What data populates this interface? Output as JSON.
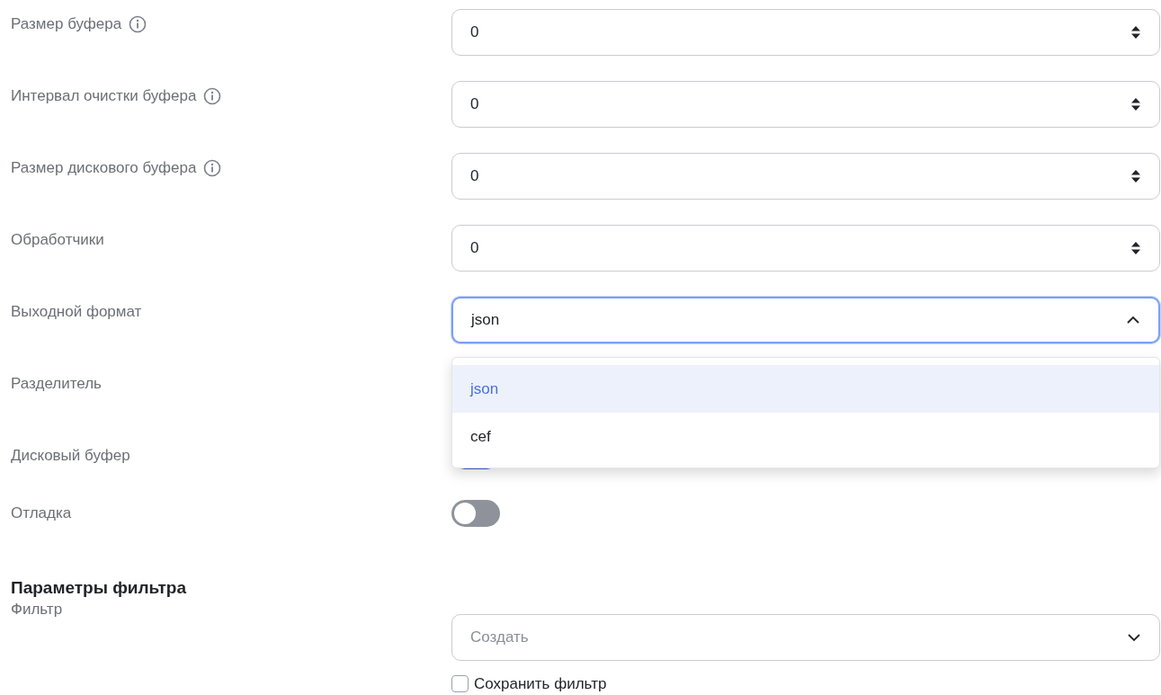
{
  "fields": [
    {
      "label": "Размер буфера",
      "info": true,
      "kind": "number",
      "value": "0"
    },
    {
      "label": "Интервал очистки буфера",
      "info": true,
      "kind": "number",
      "value": "0"
    },
    {
      "label": "Размер дискового буфера",
      "info": true,
      "kind": "number",
      "value": "0"
    },
    {
      "label": "Обработчики",
      "info": false,
      "kind": "number",
      "value": "0"
    },
    {
      "label": "Выходной формат",
      "info": false,
      "kind": "select",
      "value": "json",
      "expanded": true,
      "options": [
        {
          "label": "json",
          "selected": true
        },
        {
          "label": "cef",
          "selected": false
        }
      ]
    },
    {
      "label": "Разделитель",
      "info": false,
      "kind": "covered"
    },
    {
      "label": "Дисковый буфер",
      "info": false,
      "kind": "switch",
      "on": true
    },
    {
      "label": "Отладка",
      "info": false,
      "kind": "switch",
      "on": false
    }
  ],
  "filter_section": {
    "title": "Параметры фильтра",
    "label": "Фильтр",
    "placeholder": "Создать",
    "save_checkbox": {
      "label": "Сохранить фильтр",
      "checked": false
    }
  }
}
